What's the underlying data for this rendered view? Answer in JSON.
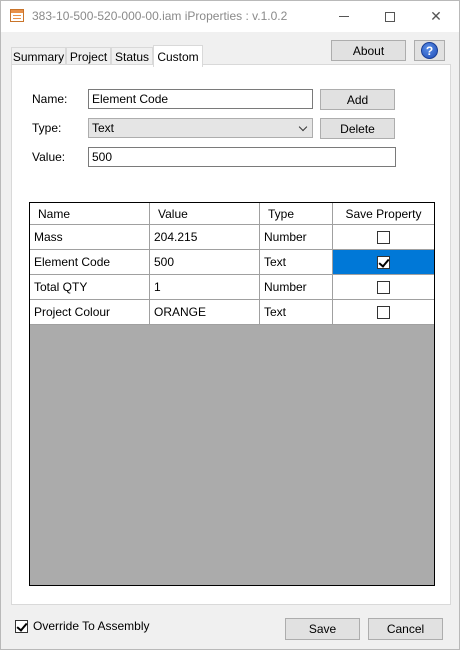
{
  "window": {
    "title": "383-10-500-520-000-00.iam iProperties : v.1.0.2",
    "minimize_icon": "minimize-icon",
    "maximize_icon": "maximize-icon",
    "close_glyph": "✕"
  },
  "tabs": [
    {
      "label": "Summary",
      "active": false
    },
    {
      "label": "Project",
      "active": false
    },
    {
      "label": "Status",
      "active": false
    },
    {
      "label": "Custom",
      "active": true
    }
  ],
  "toolbar": {
    "about_label": "About",
    "help_glyph": "?"
  },
  "form": {
    "name_label": "Name:",
    "name_value": "Element Code",
    "type_label": "Type:",
    "type_value": "Text",
    "value_label": "Value:",
    "value_value": "500",
    "add_label": "Add",
    "delete_label": "Delete"
  },
  "grid": {
    "columns": [
      "Name",
      "Value",
      "Type",
      "Save Property"
    ],
    "rows": [
      {
        "name": "Mass",
        "value": "204.215",
        "type": "Number",
        "save": false,
        "selected": false
      },
      {
        "name": "Element Code",
        "value": "500",
        "type": "Text",
        "save": true,
        "selected": true
      },
      {
        "name": "Total QTY",
        "value": "1",
        "type": "Number",
        "save": false,
        "selected": false
      },
      {
        "name": "Project Colour",
        "value": "ORANGE",
        "type": "Text",
        "save": false,
        "selected": false
      }
    ]
  },
  "footer": {
    "override_label": "Override To Assembly",
    "override_checked": true,
    "save_label": "Save",
    "cancel_label": "Cancel"
  },
  "colors": {
    "selection": "#0078d7",
    "grid_background": "#ababab",
    "help_icon": "#1f4db8"
  }
}
